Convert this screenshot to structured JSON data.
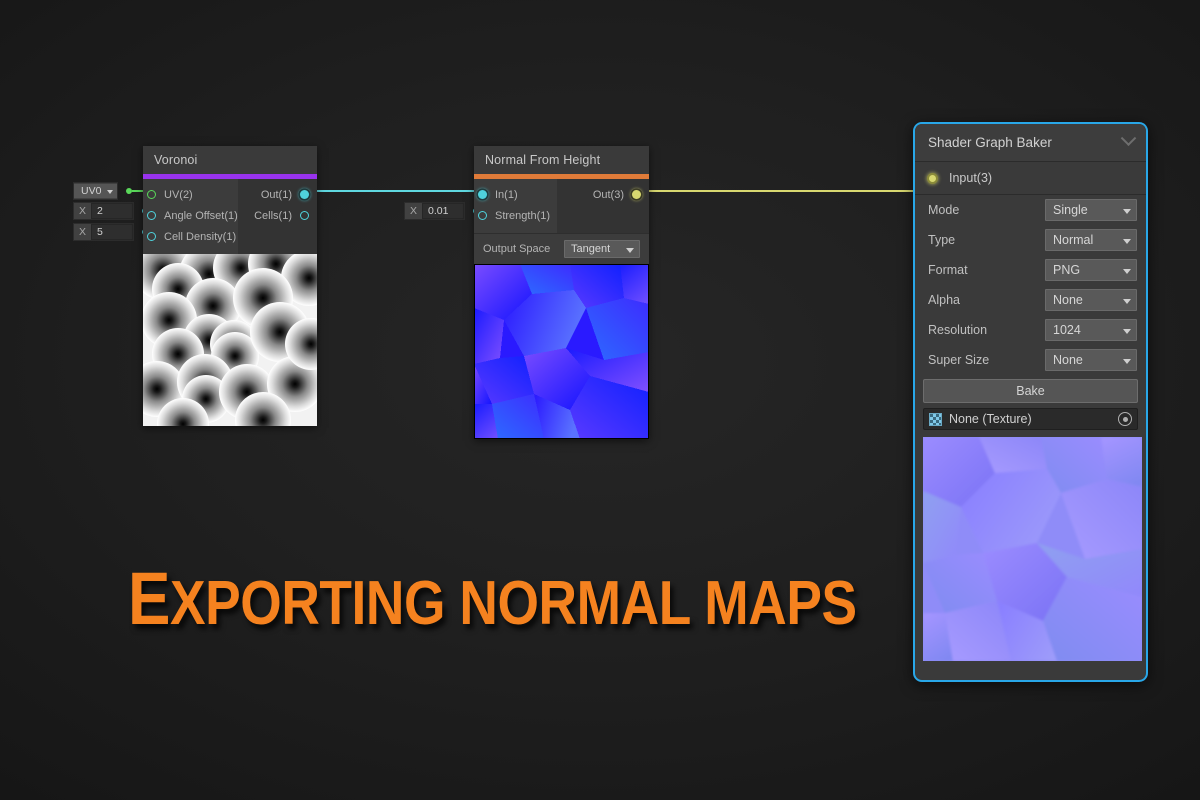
{
  "colors": {
    "background": "#1a1a1a",
    "voronoi_accent": "#9933ee",
    "normal_accent": "#e07b39",
    "panel_border": "#29a7e8",
    "wire_cyan": "#5fd8e0",
    "wire_yellow": "#d8d870",
    "port_green": "#5ad85a",
    "port_cyan": "#4fd2dc",
    "title_orange": "#f5821f"
  },
  "title": {
    "first_letter": "E",
    "rest": "XPORTING NORMAL MAPS",
    "full": "Exporting normal maps"
  },
  "voronoi_node": {
    "title": "Voronoi",
    "accent": "#9933ee",
    "inputs": [
      {
        "label": "UV(2)",
        "port_color": "#5ad85a",
        "filled": false,
        "widget": {
          "type": "dropdown",
          "axis": "",
          "value": "UV0"
        }
      },
      {
        "label": "Angle Offset(1)",
        "port_color": "#4fd2dc",
        "filled": false,
        "widget": {
          "type": "float",
          "axis": "X",
          "value": "2"
        }
      },
      {
        "label": "Cell Density(1)",
        "port_color": "#4fd2dc",
        "filled": false,
        "widget": {
          "type": "float",
          "axis": "X",
          "value": "5"
        }
      }
    ],
    "outputs": [
      {
        "label": "Out(1)",
        "port_color": "#4fd2dc",
        "filled": true
      },
      {
        "label": "Cells(1)",
        "port_color": "#4fd2dc",
        "filled": false
      }
    ],
    "preview": "voronoi-distance-field-grayscale"
  },
  "normal_node": {
    "title": "Normal From Height",
    "accent": "#e07b39",
    "inputs": [
      {
        "label": "In(1)",
        "port_color": "#4fd2dc",
        "filled": true,
        "widget": null
      },
      {
        "label": "Strength(1)",
        "port_color": "#4fd2dc",
        "filled": false,
        "widget": {
          "type": "float",
          "axis": "X",
          "value": "0.01"
        }
      }
    ],
    "outputs": [
      {
        "label": "Out(3)",
        "port_color": "#d8d870",
        "filled": true
      }
    ],
    "property": {
      "label": "Output Space",
      "value": "Tangent"
    },
    "preview": "normal-map-voronoi-blue"
  },
  "baker_panel": {
    "title": "Shader Graph Baker",
    "collapse_icon": "chevron-down-icon",
    "input_port_label": "Input(3)",
    "input_port_color": "#d8d870",
    "properties": [
      {
        "label": "Mode",
        "value": "Single"
      },
      {
        "label": "Type",
        "value": "Normal"
      },
      {
        "label": "Format",
        "value": "PNG"
      },
      {
        "label": "Alpha",
        "value": "None"
      },
      {
        "label": "Resolution",
        "value": "1024"
      },
      {
        "label": "Super Size",
        "value": "None"
      }
    ],
    "bake_button": "Bake",
    "texture_field": {
      "value": "None (Texture)",
      "icon": "texture-checker-icon",
      "picker_icon": "object-picker-icon"
    },
    "preview": "baked-normal-map-lavender"
  }
}
